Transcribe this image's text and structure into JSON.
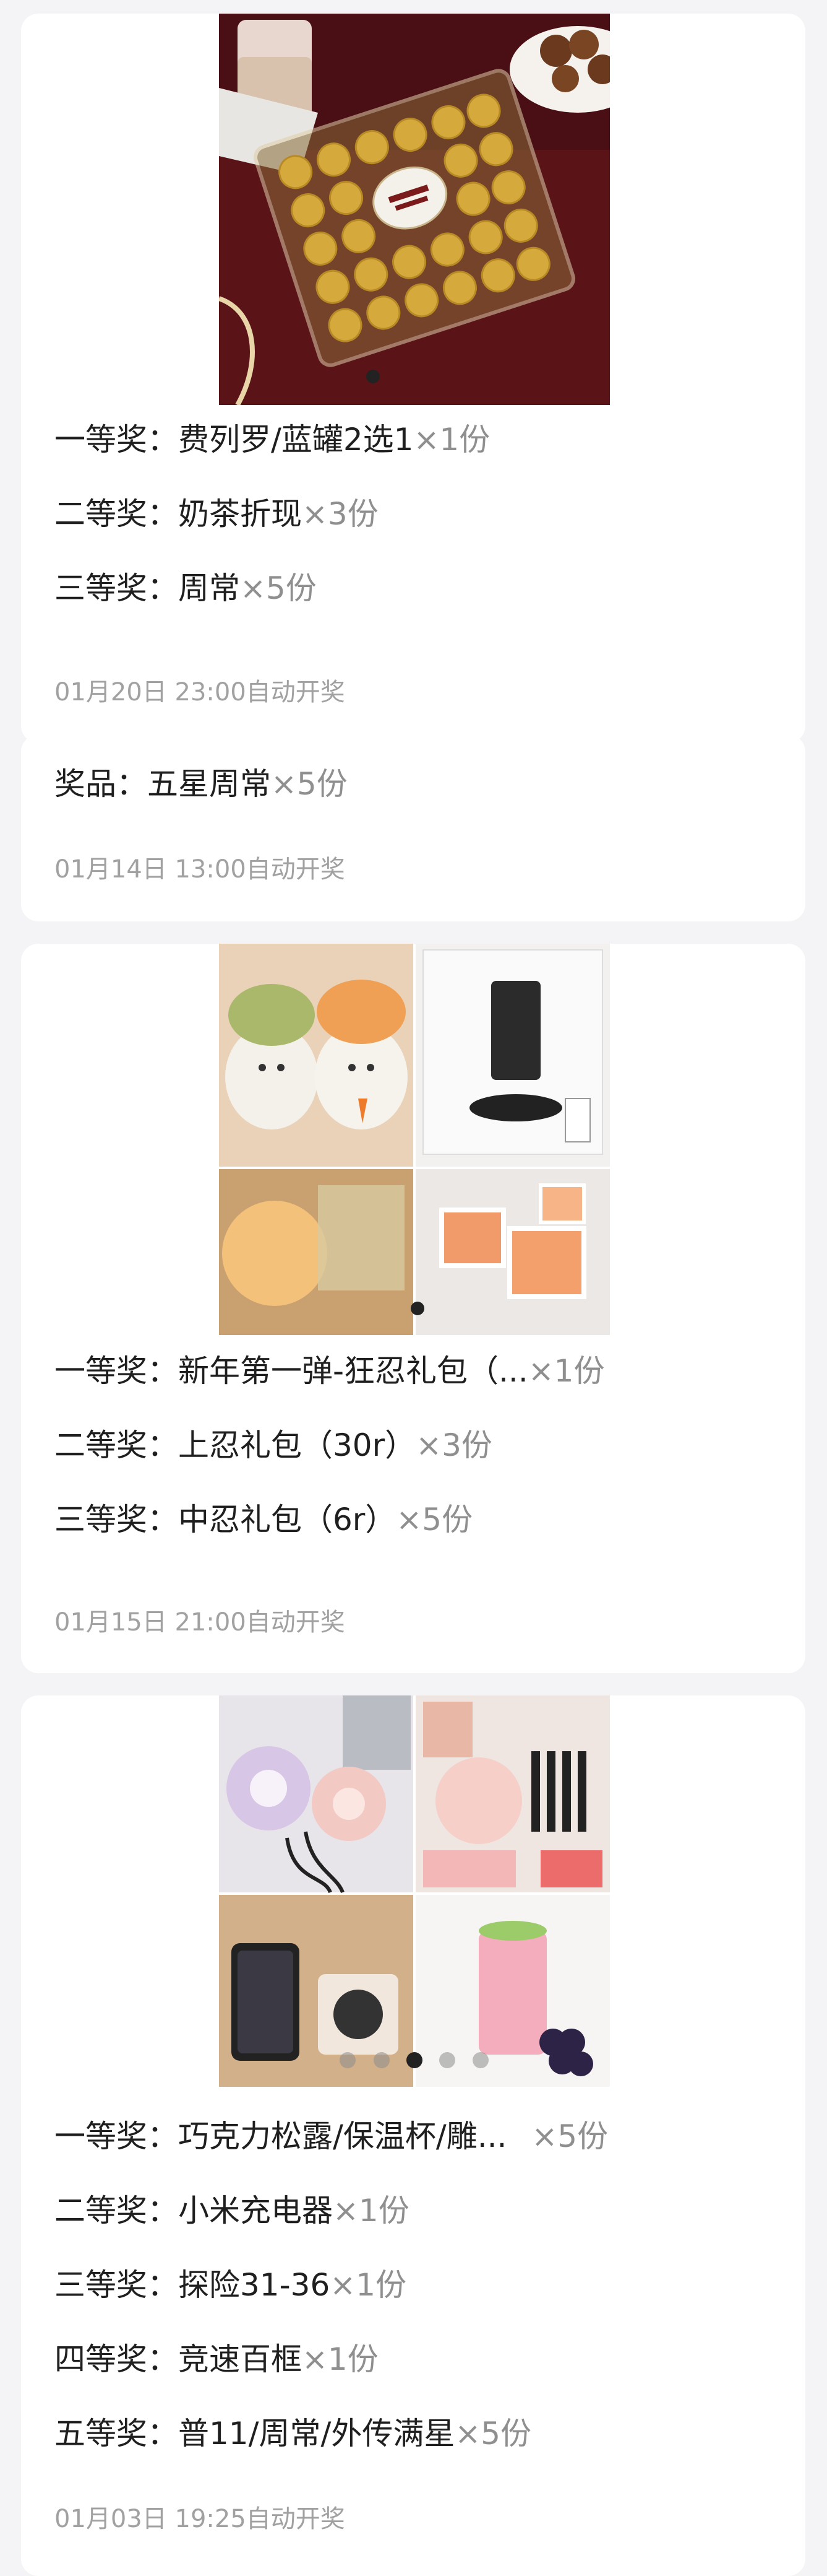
{
  "cards": [
    {
      "image": "ferrero-rocher-chocolate-box-photo",
      "prizes": [
        {
          "label": "一等奖：",
          "name": "费列罗/蓝罐2选1",
          "qty": "×1份"
        },
        {
          "label": "二等奖：",
          "name": "奶茶折现",
          "qty": "×3份"
        },
        {
          "label": "三等奖：",
          "name": "周常",
          "qty": "×5份"
        }
      ],
      "draw_time": "01月20日 23:00自动开奖"
    },
    {
      "prizes": [
        {
          "label": "奖品：",
          "name": "五星周常",
          "qty": "×5份"
        }
      ],
      "draw_time": "01月14日 13:00自动开奖"
    },
    {
      "image": "bunny-figures-wireless-charger-night-lights-collage",
      "prizes": [
        {
          "label": "一等奖：",
          "name": "新年第一弹-狂忍礼包（...",
          "qty": "×1份"
        },
        {
          "label": "二等奖：",
          "name": "上忍礼包（30r）",
          "qty": "×3份"
        },
        {
          "label": "三等奖：",
          "name": "中忍礼包（6r）",
          "qty": "×5份"
        }
      ],
      "draw_time": "01月15日 21:00自动开奖"
    },
    {
      "image": "power-banks-cables-phone-milk-tea-collage",
      "prizes": [
        {
          "label": "一等奖：",
          "name": "巧克力松露/保温杯/雕...",
          "qty": "×5份"
        },
        {
          "label": "二等奖：",
          "name": "小米充电器",
          "qty": "×1份"
        },
        {
          "label": "三等奖：",
          "name": "探险31-36",
          "qty": "×1份"
        },
        {
          "label": "四等奖：",
          "name": "竞速百框",
          "qty": "×1份"
        },
        {
          "label": "五等奖：",
          "name": "普11/周常/外传满星",
          "qty": "×5份"
        }
      ],
      "draw_time": "01月03日 19:25自动开奖"
    }
  ],
  "colors": {
    "page_background": "#f4f4f6",
    "card_background": "#ffffff",
    "text_primary": "#1f1f1f",
    "text_quantity": "#8f8f8f",
    "text_time": "#a1a1a1"
  }
}
